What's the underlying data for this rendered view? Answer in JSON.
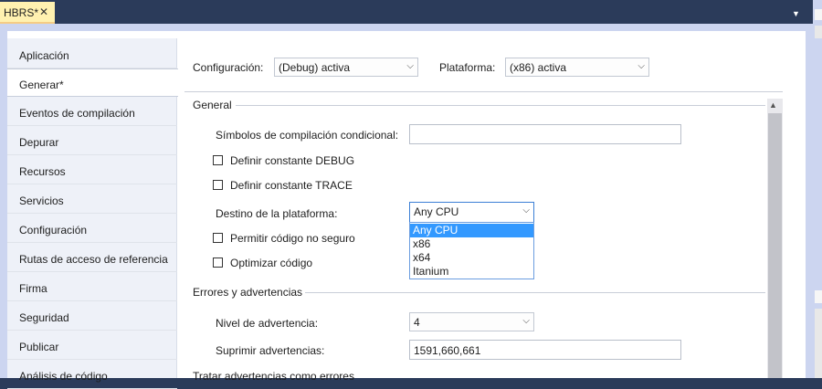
{
  "tab": {
    "title": "HBRS*",
    "close": "✕"
  },
  "nav": {
    "items": [
      {
        "label": "Aplicación"
      },
      {
        "label": "Generar*",
        "active": true
      },
      {
        "label": "Eventos de compilación"
      },
      {
        "label": "Depurar"
      },
      {
        "label": "Recursos"
      },
      {
        "label": "Servicios"
      },
      {
        "label": "Configuración"
      },
      {
        "label": "Rutas de acceso de referencia"
      },
      {
        "label": "Firma"
      },
      {
        "label": "Seguridad"
      },
      {
        "label": "Publicar"
      },
      {
        "label": "Análisis de código"
      }
    ]
  },
  "header": {
    "config_label": "Configuración:",
    "config_value": "(Debug) activa",
    "platform_label": "Plataforma:",
    "platform_value": "(x86) activa"
  },
  "general": {
    "title": "General",
    "symbols_label": "Símbolos de compilación condicional:",
    "symbols_value": "",
    "debug_label": "Definir constante DEBUG",
    "debug_checked": false,
    "trace_label": "Definir constante TRACE",
    "trace_checked": false,
    "target_label": "Destino de la plataforma:",
    "target_value": "Any CPU",
    "target_options": [
      "Any CPU",
      "x86",
      "x64",
      "Itanium"
    ],
    "unsafe_label": "Permitir código no seguro",
    "unsafe_checked": false,
    "optimize_label": "Optimizar código",
    "optimize_checked": false
  },
  "errors": {
    "title": "Errores y advertencias",
    "warning_level_label": "Nivel de advertencia:",
    "warning_level_value": "4",
    "suppress_label": "Suprimir advertencias:",
    "suppress_value": "1591,660,661"
  },
  "partial_section": {
    "title": "Tratar advertencias como errores"
  },
  "colors": {
    "accent": "#3399ff",
    "frame": "#ccd5f0",
    "tab_active": "#fff1b0",
    "chrome": "#2b3b5a"
  }
}
